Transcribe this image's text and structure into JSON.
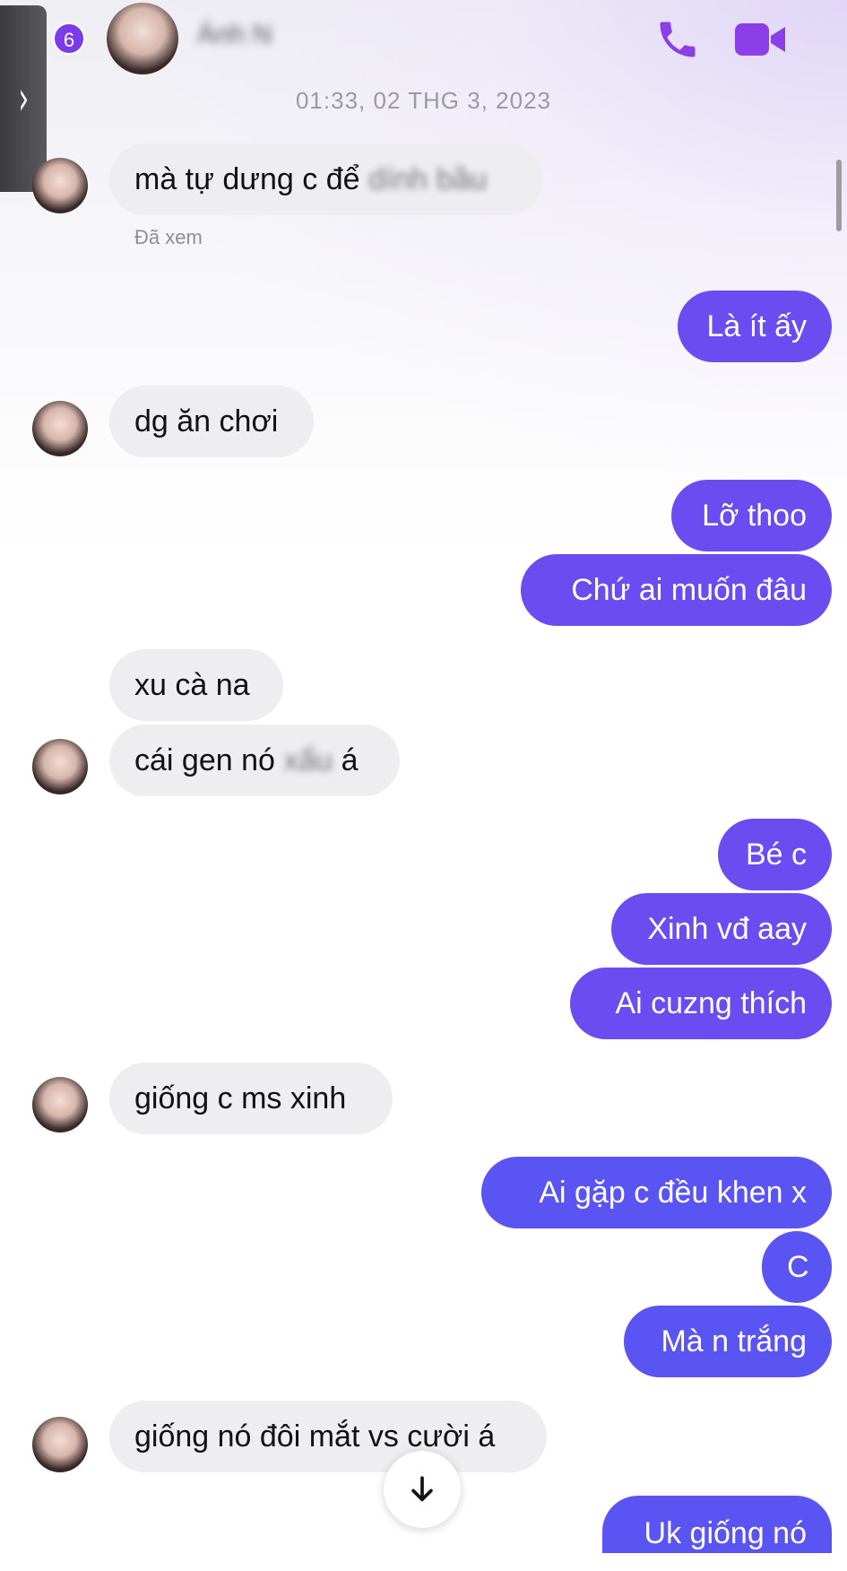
{
  "header": {
    "back_glyph": "›",
    "unread_count": "6",
    "contact_name": "Ánh Ngọc",
    "call_icon": "phone-icon",
    "video_icon": "video-camera-icon",
    "accent_color": "#7b3be8"
  },
  "timestamp": "01:33, 02 THG 3, 2023",
  "seen_label": "Đã xem",
  "messages": [
    {
      "side": "in",
      "text": "mà tự dưng c để ",
      "blurred_tail": "dính bầu"
    },
    {
      "side": "out",
      "text": "Là ít ấy"
    },
    {
      "side": "in",
      "text": "dg ăn chơi"
    },
    {
      "side": "out",
      "text": "Lỡ thoo"
    },
    {
      "side": "out",
      "text": "Chứ ai  muốn đâu"
    },
    {
      "side": "in",
      "text": "xu cà na"
    },
    {
      "side": "in",
      "text": "cái gen nó ",
      "blurred_tail": "xấu",
      "tail": " á"
    },
    {
      "side": "out",
      "text": "Bé c"
    },
    {
      "side": "out",
      "text": "Xinh vđ aay"
    },
    {
      "side": "out",
      "text": "Ai cuzng thích"
    },
    {
      "side": "in",
      "text": "giống c ms xinh"
    },
    {
      "side": "out",
      "text": "Ai gặp  c đều khen x"
    },
    {
      "side": "out",
      "text": "C"
    },
    {
      "side": "out",
      "text": "Mà n trắng"
    },
    {
      "side": "in",
      "text": "giống nó đôi mắt vs cười á"
    },
    {
      "side": "out",
      "text": "Uk giống nó"
    }
  ],
  "scroll_down_icon": "arrow-down-icon"
}
